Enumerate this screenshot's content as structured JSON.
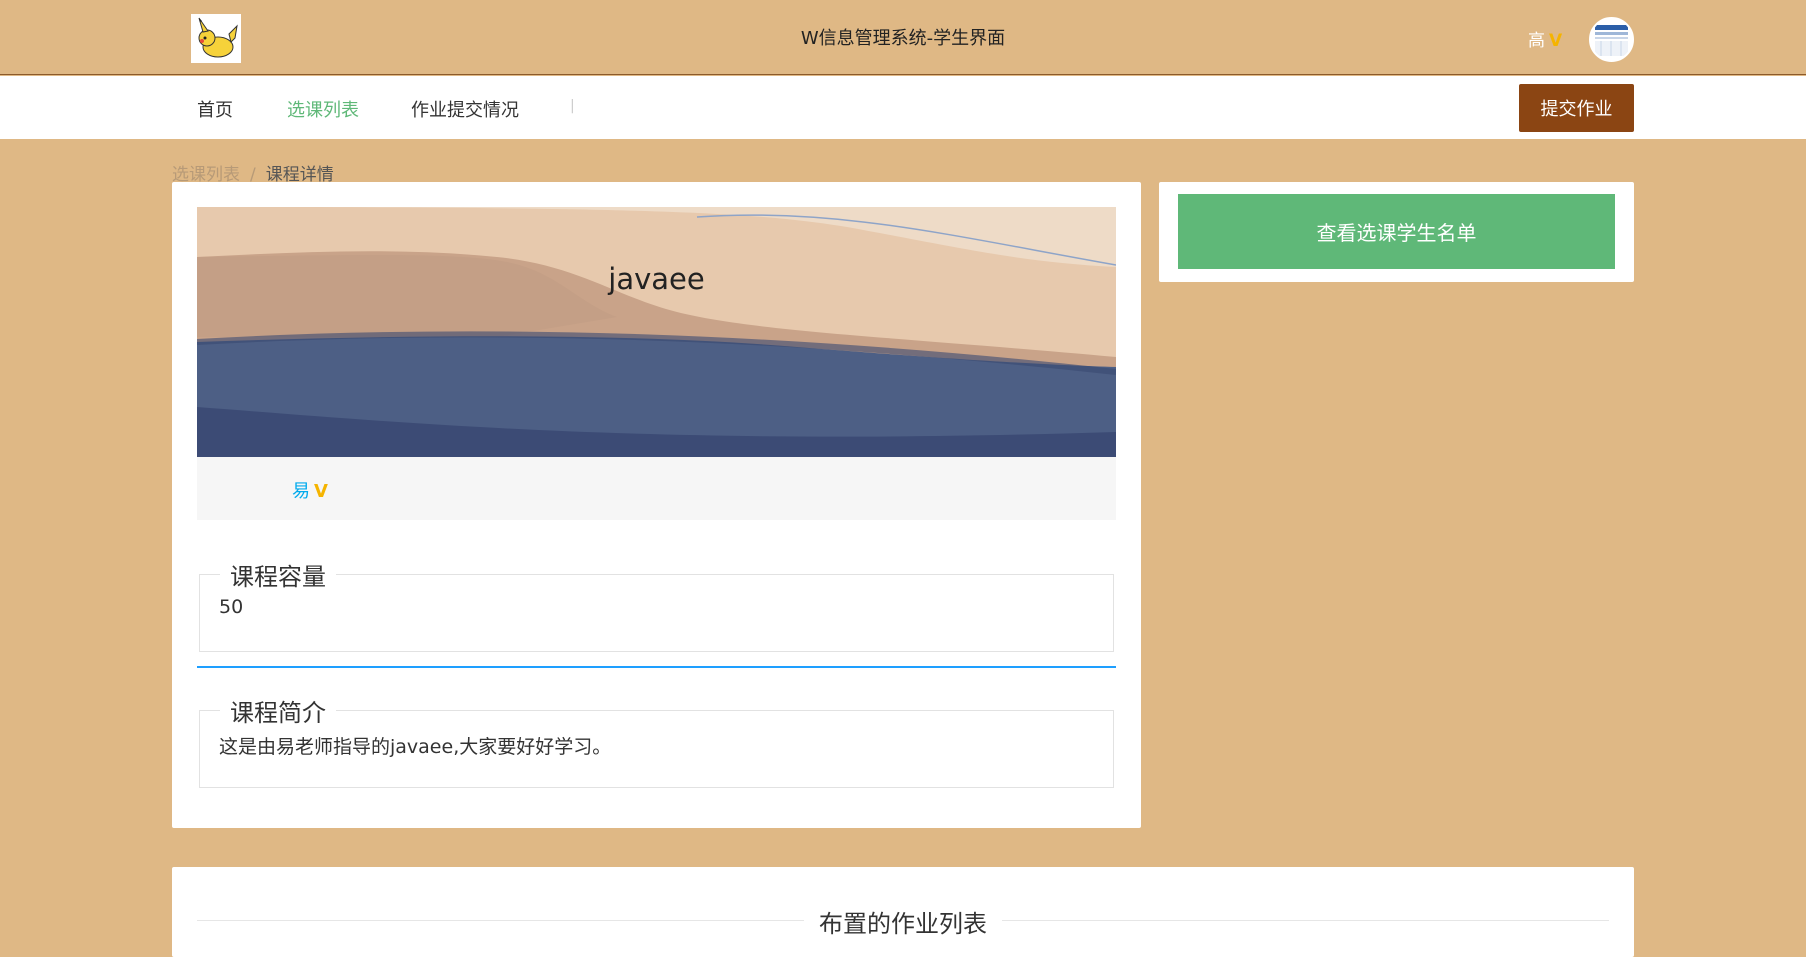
{
  "header": {
    "title": "W信息管理系统-学生界面",
    "user_name": "高",
    "vip_icon": "V",
    "logo_icon": "pikachu-logo",
    "avatar_icon": "user-avatar"
  },
  "nav": {
    "items": [
      {
        "label": "首页",
        "active": false
      },
      {
        "label": "选课列表",
        "active": true
      },
      {
        "label": "作业提交情况",
        "active": false
      }
    ],
    "separator": "|",
    "submit_button": "提交作业"
  },
  "breadcrumb": {
    "parent": "选课列表",
    "separator": "/",
    "current": "课程详情"
  },
  "course": {
    "name": "javaee",
    "teacher": "易",
    "teacher_vip": "V",
    "capacity_label": "课程容量",
    "capacity_value": "50",
    "intro_label": "课程简介",
    "intro_value": "这是由易老师指导的javaee,大家要好好学习。"
  },
  "sidebar": {
    "roster_button": "查看选课学生名单"
  },
  "homework": {
    "title": "布置的作业列表"
  },
  "colors": {
    "page_bg": "#dfb885",
    "active_nav": "#5fb878",
    "submit_btn": "#8b4513",
    "roster_btn": "#5fb878",
    "teacher_link": "#01aaed",
    "divider_blue": "#1e9fff"
  }
}
